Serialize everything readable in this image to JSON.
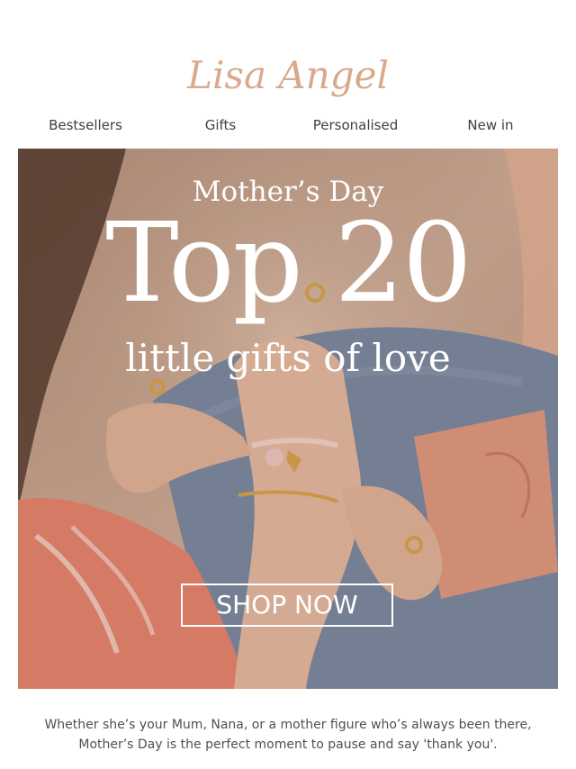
{
  "brand": {
    "logo_text": "Lisa Angel",
    "logo_color": "#d9a98c"
  },
  "nav": {
    "items": [
      {
        "label": "Bestsellers"
      },
      {
        "label": "Gifts"
      },
      {
        "label": "Personalised"
      },
      {
        "label": "New in"
      }
    ]
  },
  "hero": {
    "eyebrow": "Mother’s Day",
    "headline": "Top 20",
    "subhead": "little gifts of love",
    "cta_label": "SHOP NOW",
    "colors": {
      "background": "#c9a48f",
      "skin": "#e8b9a0",
      "coral": "#e8866e",
      "denim": "#7e8aa1",
      "card": "#e19980",
      "gold": "#d9a34a"
    }
  },
  "intro": {
    "line1": "Whether she’s your Mum, Nana, or a mother figure who’s always been there,",
    "line2": "Mother’s Day is the perfect moment to pause and say 'thank you'."
  }
}
